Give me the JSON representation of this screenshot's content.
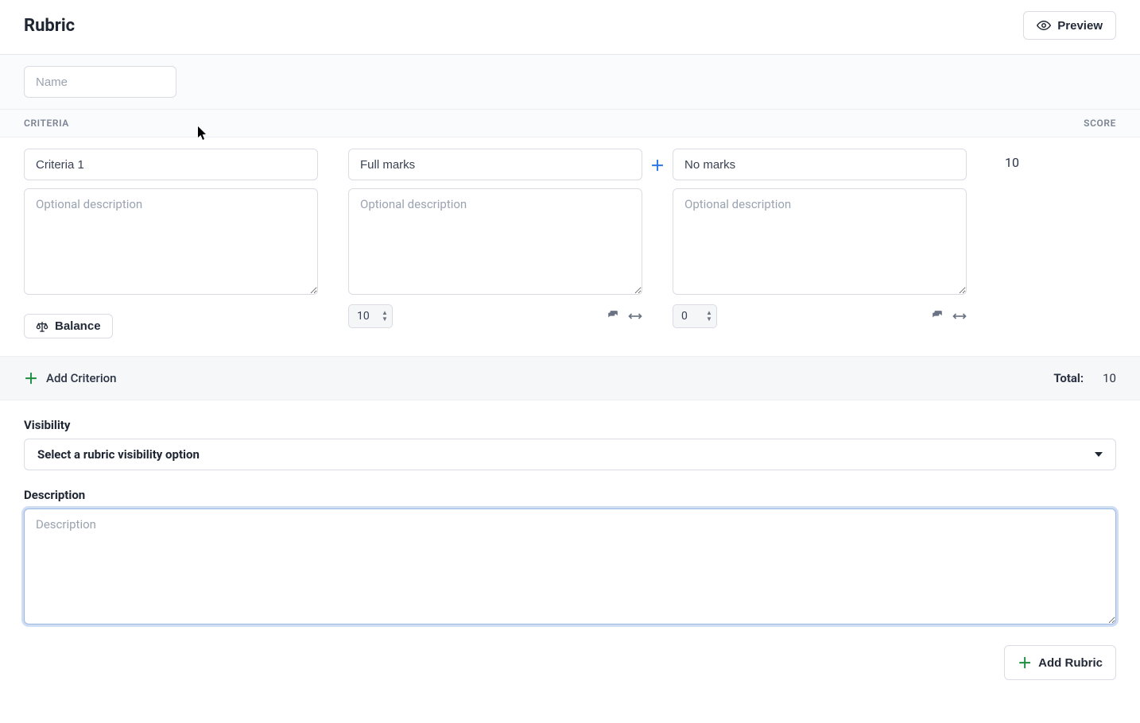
{
  "header": {
    "title": "Rubric",
    "preview_label": "Preview"
  },
  "name": {
    "placeholder": "Name",
    "value": ""
  },
  "columns": {
    "criteria_label": "CRITERIA",
    "score_label": "SCORE"
  },
  "criterion": {
    "name_value": "Criteria 1",
    "desc_placeholder": "Optional description",
    "balance_label": "Balance"
  },
  "levels": [
    {
      "name": "Full marks",
      "desc_placeholder": "Optional description",
      "points": "10"
    },
    {
      "name": "No marks",
      "desc_placeholder": "Optional description",
      "points": "0"
    }
  ],
  "row_score": "10",
  "add_criterion_label": "Add Criterion",
  "total_label": "Total:",
  "total_value": "10",
  "visibility": {
    "label": "Visibility",
    "selected": "Select a rubric visibility option"
  },
  "description": {
    "label": "Description",
    "placeholder": "Description",
    "value": ""
  },
  "footer": {
    "add_rubric_label": "Add Rubric"
  }
}
